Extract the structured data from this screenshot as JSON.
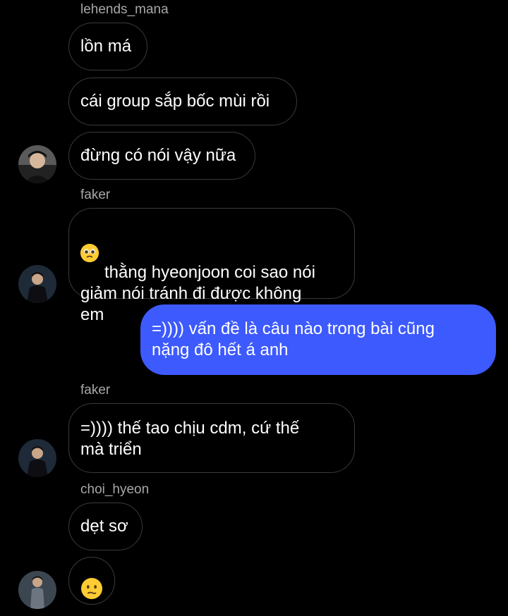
{
  "messages": [
    {
      "sender": "lehends_mana"
    },
    {
      "text": "lồn má"
    },
    {
      "text": "cái group sắp bốc mùi rồi"
    },
    {
      "text": "đừng có nói vậy nữa"
    },
    {
      "sender": "faker"
    },
    {
      "text": "thằng hyeonjoon coi sao nói\ngiảm nói tránh đi được không\nem",
      "emoji": "pleading-face"
    },
    {
      "text": "=)))) vấn đề là câu nào trong bài cũng\nnặng đô hết á anh",
      "mine": true
    },
    {
      "sender": "faker"
    },
    {
      "text": "=)))) thế tao chịu cdm, cứ thế\nmà triển"
    },
    {
      "sender": "choi_hyeon"
    },
    {
      "text": "dẹt sơ"
    },
    {
      "emoji": "confused-face"
    }
  ],
  "colors": {
    "background": "#000000",
    "outgoing_bubble": "#3d5afe",
    "incoming_border": "#3a3a3a",
    "sender_text": "#a8a8a8"
  }
}
